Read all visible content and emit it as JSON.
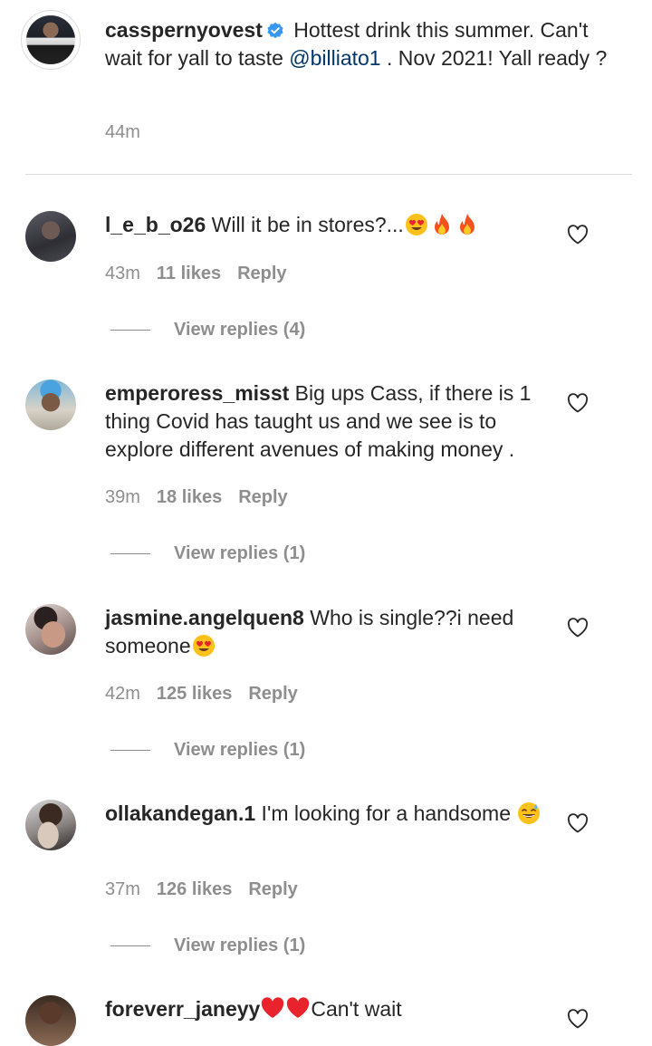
{
  "post": {
    "username": "cassperny​ovest",
    "text_before_mention": " Hottest drink this summer. Can't wait for yall to taste ",
    "mention": "@billiato1",
    "text_after_mention": " . Nov 2021! Yall ready ?",
    "time": "44m"
  },
  "comments": [
    {
      "username": "l_e_b_o26",
      "text": " Will it be in stores?...",
      "emojis": [
        "heart-eyes",
        "fire",
        "fire"
      ],
      "time": "43m",
      "likes": "11 likes",
      "reply": "Reply",
      "view_replies": "View replies (4)"
    },
    {
      "username": "emperoress_misst",
      "text": " Big ups Cass, if there is 1 thing Covid has taught us and we see is to explore different avenues of making money .",
      "time": "39m",
      "likes": "18 likes",
      "reply": "Reply",
      "view_replies": "View replies (1)"
    },
    {
      "username": "jasmine.angelquen8",
      "text": " Who is single??i need someone",
      "emojis": [
        "heart-eyes"
      ],
      "time": "42m",
      "likes": "125 likes",
      "reply": "Reply",
      "view_replies": "View replies (1)"
    },
    {
      "username": "ollakandegan.1",
      "text": " I'm looking for a handsome ",
      "emojis": [
        "grinning-sweat"
      ],
      "time": "37m",
      "likes": "126 likes",
      "reply": "Reply",
      "view_replies": "View replies (1)"
    },
    {
      "username": "foreverr_janeyy",
      "text": "Can't wait",
      "emojis": [
        "red-heart",
        "red-heart"
      ]
    }
  ],
  "colors": {
    "text": "#262626",
    "muted": "#8e8e8e",
    "mention": "#00376b",
    "verified": "#3897f0",
    "divider": "#dbdbdb"
  }
}
